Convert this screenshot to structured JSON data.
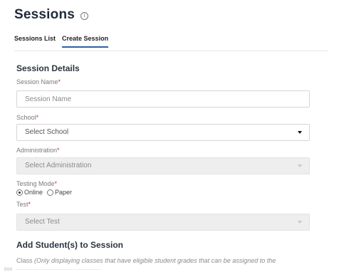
{
  "page": {
    "title": "Sessions",
    "info_icon": "info-circle-icon"
  },
  "tabs": [
    {
      "label": "Sessions List",
      "active": false
    },
    {
      "label": "Create Session",
      "active": true
    }
  ],
  "session_details": {
    "heading": "Session Details",
    "session_name": {
      "label": "Session Name",
      "required_mark": "*",
      "placeholder": "Session Name",
      "value": ""
    },
    "school": {
      "label": "School",
      "required_mark": "*",
      "selected": "Select School",
      "disabled": false
    },
    "administration": {
      "label": "Administration",
      "required_mark": "*",
      "selected": "Select Administration",
      "disabled": true
    },
    "testing_mode": {
      "label": "Testing Mode",
      "required_mark": "*",
      "options": [
        {
          "label": "Online",
          "checked": true
        },
        {
          "label": "Paper",
          "checked": false
        }
      ]
    },
    "test": {
      "label": "Test",
      "required_mark": "*",
      "selected": "Select Test",
      "disabled": true
    }
  },
  "add_students": {
    "heading": "Add Student(s) to Session",
    "class_label": "Class",
    "class_note": "(Only displaying classes that have eligible student grades that can be assigned to the",
    "cutoff_text": "tion"
  },
  "colors": {
    "tab_underline": "#2e5fa3",
    "required": "#c0392b",
    "disabled_bg": "#eeeeee"
  }
}
